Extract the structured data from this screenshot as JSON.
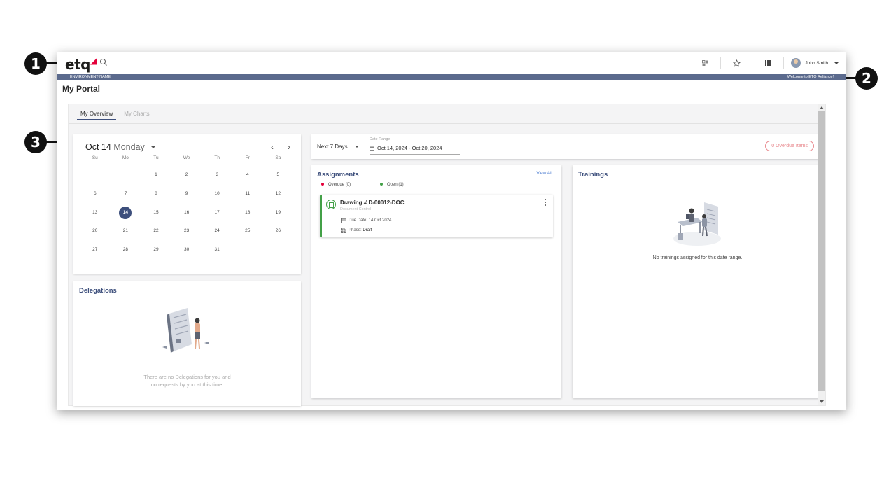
{
  "callouts": [
    "1",
    "2",
    "3"
  ],
  "header": {
    "logo_text": "etq",
    "user_name": "John Smith",
    "environment": "ENVIRONMENT-NAME",
    "welcome": "Welcome to ETQ Reliance!"
  },
  "page": {
    "title": "My Portal"
  },
  "tabs": [
    {
      "label": "My Overview",
      "active": true
    },
    {
      "label": "My Charts",
      "active": false
    }
  ],
  "calendar": {
    "date_label": "Oct 14",
    "weekday_label": "Monday",
    "prev": "‹",
    "next": "›",
    "weekdays": [
      "Su",
      "Mo",
      "Tu",
      "We",
      "Th",
      "Fr",
      "Sa"
    ],
    "days": [
      "",
      "",
      "1",
      "2",
      "3",
      "4",
      "5",
      "6",
      "7",
      "8",
      "9",
      "10",
      "11",
      "12",
      "13",
      "14",
      "15",
      "16",
      "17",
      "18",
      "19",
      "20",
      "21",
      "22",
      "23",
      "24",
      "25",
      "26",
      "27",
      "28",
      "29",
      "30",
      "31"
    ],
    "selected": "14"
  },
  "delegations": {
    "title": "Delegations",
    "empty_line1": "There are no Delegations for you and",
    "empty_line2": "no requests by you at this time."
  },
  "filter": {
    "range_select": "Next 7 Days",
    "date_range_label": "Date Range",
    "date_range_value": "Oct 14, 2024 - Oct 20, 2024",
    "overdue_items": "0 Overdue Items"
  },
  "assignments": {
    "title": "Assignments",
    "view_all": "View All",
    "legend_overdue": "Overdue (0)",
    "legend_open": "Open (1)",
    "task": {
      "title": "Drawing # D-00012-DOC",
      "subtitle": "Document Control",
      "due_date": "Due Date: 14 Oct 2024",
      "phase_label": "Phase:",
      "phase_value": "Draft"
    }
  },
  "trainings": {
    "title": "Trainings",
    "empty": "No trainings assigned for this date range."
  },
  "colors": {
    "brand_navy": "#3d4f7c",
    "env_bar": "#5b6a8d",
    "overdue_red": "#e4003a",
    "open_green": "#43a047",
    "link_blue": "#4a7bd0"
  },
  "icons": [
    "search-icon",
    "layout-icon",
    "star-icon",
    "apps-grid-icon",
    "user-avatar",
    "chevron-down-icon",
    "calendar-icon",
    "document-icon",
    "kebab-menu-icon",
    "phase-icon"
  ]
}
